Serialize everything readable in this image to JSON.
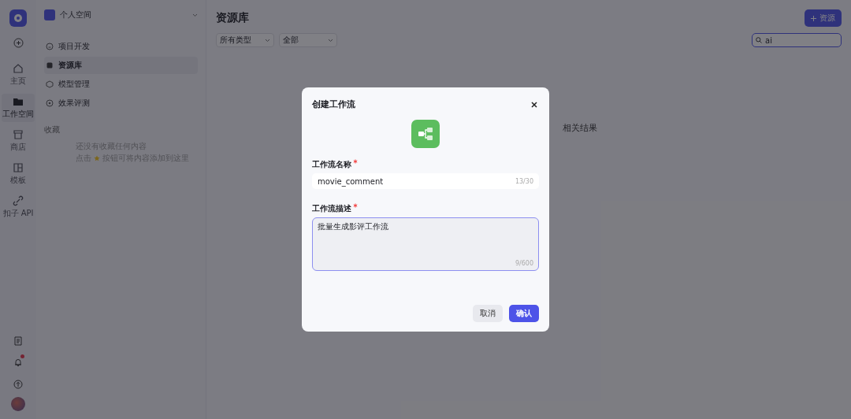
{
  "rail": {
    "items": [
      {
        "label": "主页",
        "selected": false,
        "kind": "home"
      },
      {
        "label": "工作空间",
        "selected": true,
        "kind": "workspace"
      },
      {
        "label": "商店",
        "selected": false,
        "kind": "store"
      },
      {
        "label": "模板",
        "selected": false,
        "kind": "template"
      },
      {
        "label": "扣子 API",
        "selected": false,
        "kind": "api"
      }
    ],
    "notifications": {
      "unread": true
    }
  },
  "sidebar": {
    "workspace": "个人空间",
    "items": [
      {
        "label": "项目开发",
        "selected": false,
        "kind": "project"
      },
      {
        "label": "资源库",
        "selected": true,
        "kind": "library"
      },
      {
        "label": "模型管理",
        "selected": false,
        "kind": "model"
      },
      {
        "label": "效果评测",
        "selected": false,
        "kind": "eval"
      }
    ],
    "favorites_title": "收藏",
    "empty_line_1": "还没有收藏任何内容",
    "empty_line_2_before": "点击",
    "empty_line_2_after": "按钮可将内容添加到这里"
  },
  "main": {
    "title": "资源库",
    "add_button": "资源",
    "filters": [
      {
        "value": "所有类型"
      },
      {
        "value": "全部"
      }
    ],
    "search": {
      "value": "ai"
    },
    "empty_text": "相关结果"
  },
  "dialog": {
    "title": "创建工作流",
    "fields": [
      {
        "label": "工作流名称",
        "required": true,
        "kind": "input",
        "value": "movie_comment",
        "counter": "13/30",
        "focused": false
      },
      {
        "label": "工作流描述",
        "required": true,
        "kind": "textarea",
        "value": "批量生成影评工作流",
        "counter": "9/600",
        "focused": true
      }
    ],
    "buttons": [
      {
        "label": "取消",
        "kind": "secondary"
      },
      {
        "label": "确认",
        "kind": "primary"
      }
    ]
  }
}
